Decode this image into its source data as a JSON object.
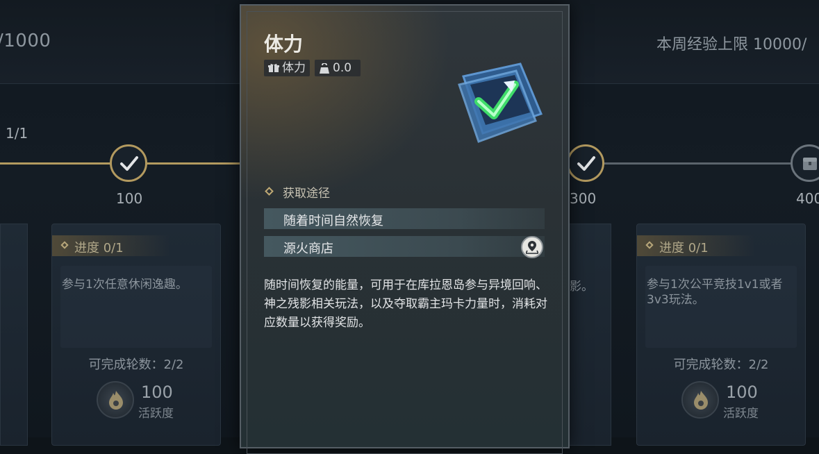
{
  "top": {
    "left_value": "/1000",
    "right_value": "本周经验上限 10000/"
  },
  "track": {
    "fraction": "1/1",
    "nodes": [
      "100",
      "300",
      "400"
    ]
  },
  "cards": [
    {
      "progress": "进度 0/1",
      "description": "参与1次任意休闲逸趣。",
      "rounds": "可完成轮数：2/2",
      "points": "100",
      "points_label": "活跃度"
    },
    {
      "progress": "进度 0/1",
      "description": "参与1次公平竞技1v1或者3v3玩法。",
      "rounds": "可完成轮数：2/2",
      "points": "100",
      "points_label": "活跃度"
    }
  ],
  "partial_card_text": "影。",
  "popup": {
    "title": "体力",
    "tags": {
      "type": "体力",
      "weight": "0.0"
    },
    "source_heading": "获取途径",
    "sources": [
      "随着时间自然恢复",
      "源火商店"
    ],
    "description": "随时间恢复的能量，可用于在库拉恩岛参与异境回响、神之残影相关玩法，以及夺取霸主玛卡力量时，消耗对应数量以获得奖励。",
    "colors": {
      "accent_gold": "#b39a5f",
      "item_green": "#3fdc6a",
      "item_blue": "#4a86c8"
    }
  }
}
